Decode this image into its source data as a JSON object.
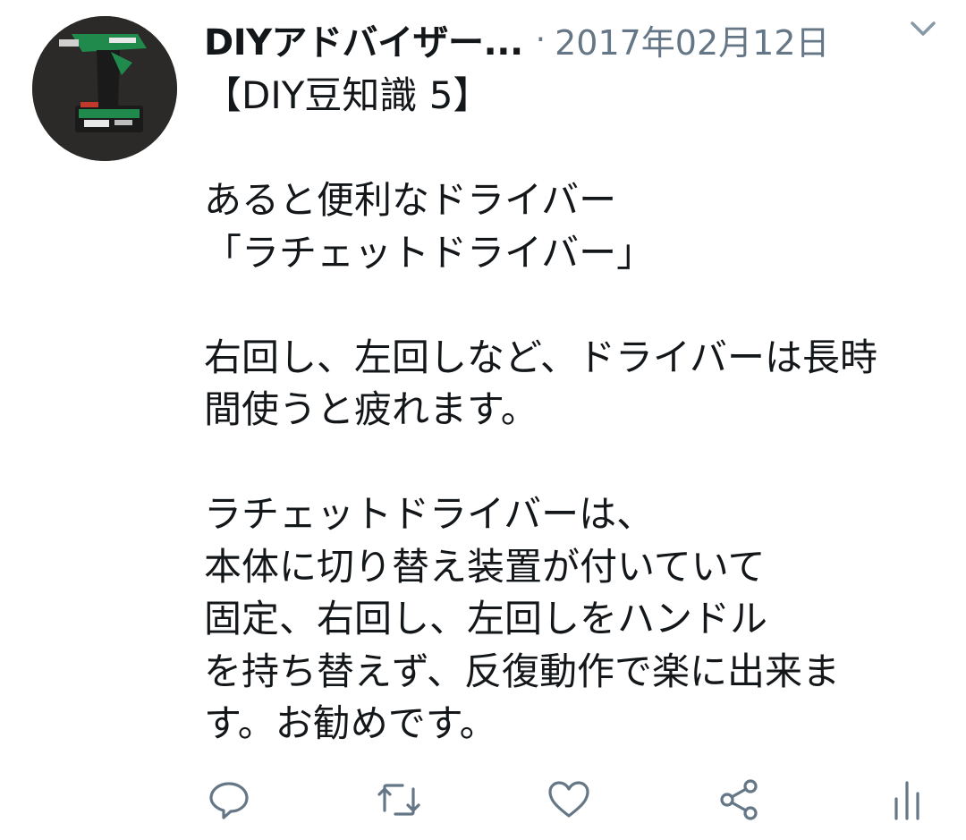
{
  "tweet": {
    "author_name": "DIYアドバイザー...",
    "separator": "·",
    "date": "2017年02月12日",
    "lines": [
      "【DIY豆知識 5】",
      "",
      "あると便利なドライバー",
      "「ラチェットドライバー」",
      "",
      "右回し、左回しなど、ドライバーは長時",
      "間使うと疲れます。",
      "",
      "ラチェットドライバーは、",
      "本体に切り替え装置が付いていて",
      "固定、右回し、左回しをハンドル",
      "を持ち替えず、反復動作で楽に出来ま",
      "す。お勧めです。"
    ]
  },
  "avatar_icon": "impact-driver-photo",
  "actions": [
    {
      "name": "reply-icon"
    },
    {
      "name": "retweet-icon"
    },
    {
      "name": "like-icon"
    },
    {
      "name": "share-icon"
    },
    {
      "name": "analytics-icon"
    }
  ],
  "colors": {
    "text": "#14171a",
    "secondary": "#657786",
    "avatar_bg": "#2b2a28",
    "tool_green": "#1f8a4c"
  }
}
